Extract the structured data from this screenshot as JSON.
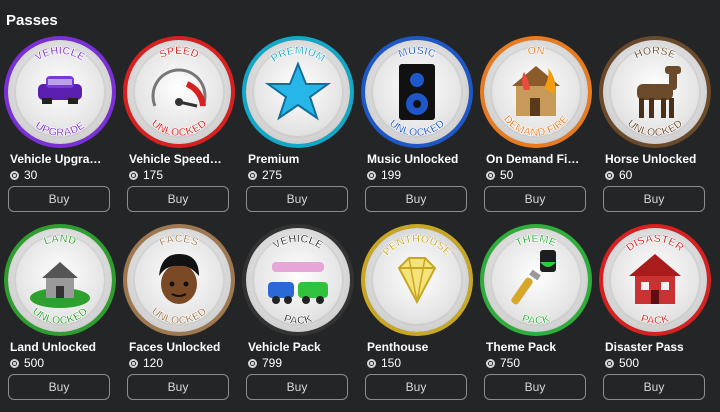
{
  "section": {
    "title": "Passes"
  },
  "buy_label": "Buy",
  "rows": [
    [
      {
        "name": "Vehicle Upgra…",
        "price": "30",
        "badge_top": "VEHICLE",
        "badge_bottom": "UPGRADE",
        "ring_color": "#7b2fd6",
        "icon": "purple-car-icon"
      },
      {
        "name": "Vehicle Speed…",
        "price": "175",
        "badge_top": "SPEED",
        "badge_bottom": "UNLOCKED",
        "ring_color": "#d82020",
        "icon": "speedometer-icon"
      },
      {
        "name": "Premium",
        "price": "275",
        "badge_top": "PREMIUM",
        "badge_bottom": "",
        "ring_color": "#12a8c8",
        "icon": "blue-star-icon"
      },
      {
        "name": "Music Unlocked",
        "price": "199",
        "badge_top": "MUSIC",
        "badge_bottom": "UNLOCKED",
        "ring_color": "#1d57c8",
        "icon": "speaker-icon"
      },
      {
        "name": "On Demand Fi…",
        "price": "50",
        "badge_top": "ON",
        "badge_bottom": "DEMAND FIRE",
        "ring_color": "#e87b1e",
        "icon": "burning-house-icon"
      },
      {
        "name": "Horse Unlocked",
        "price": "60",
        "badge_top": "HORSE",
        "badge_bottom": "UNLOCKED",
        "ring_color": "#6a4a2a",
        "icon": "horse-icon"
      }
    ],
    [
      {
        "name": "Land Unlocked",
        "price": "500",
        "badge_top": "LAND",
        "badge_bottom": "UNLOCKED",
        "ring_color": "#2e9e2e",
        "icon": "land-house-icon"
      },
      {
        "name": "Faces Unlocked",
        "price": "120",
        "badge_top": "FACES",
        "badge_bottom": "UNLOCKED",
        "ring_color": "#a07850",
        "icon": "face-icon"
      },
      {
        "name": "Vehicle Pack",
        "price": "799",
        "badge_top": "VEHICLE",
        "badge_bottom": "PACK",
        "ring_color": "#333333",
        "icon": "vehicles-icon"
      },
      {
        "name": "Penthouse",
        "price": "150",
        "badge_top": "PENTHOUSE",
        "badge_bottom": "",
        "ring_color": "#c8a822",
        "icon": "diamond-icon"
      },
      {
        "name": "Theme Pack",
        "price": "750",
        "badge_top": "THEME",
        "badge_bottom": "PACK",
        "ring_color": "#2eae3a",
        "icon": "paintbrush-icon"
      },
      {
        "name": "Disaster Pass",
        "price": "500",
        "badge_top": "DISASTER",
        "badge_bottom": "PACK",
        "ring_color": "#d82020",
        "icon": "broken-house-icon"
      }
    ]
  ]
}
